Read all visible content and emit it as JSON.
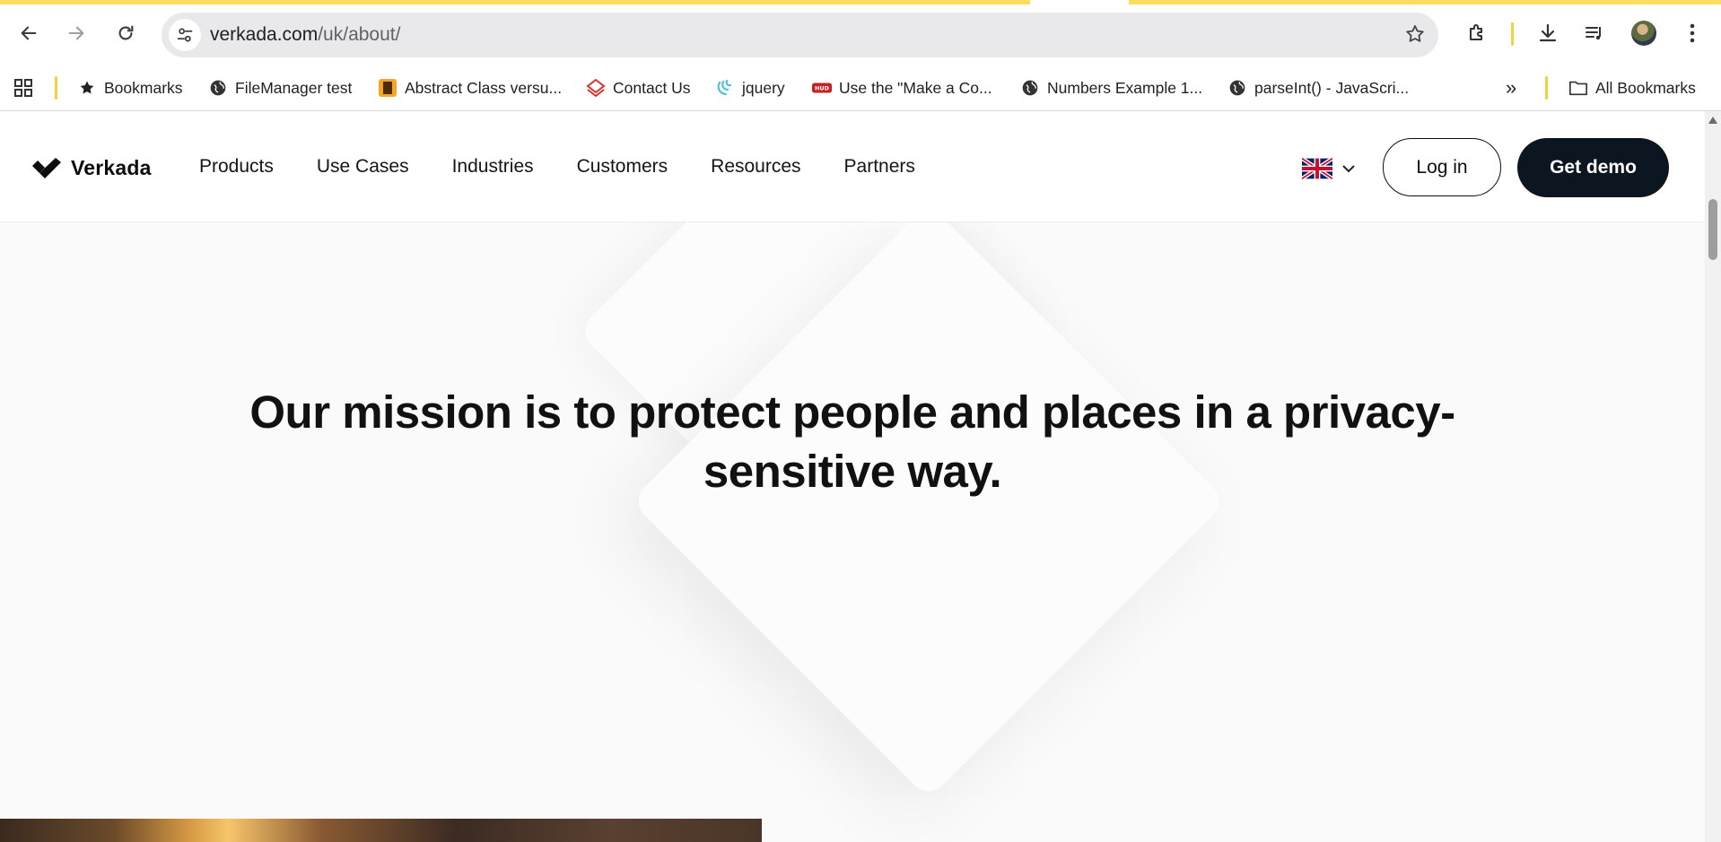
{
  "browser": {
    "url_host": "verkada.com",
    "url_path": "/uk/about/",
    "bookmarks": [
      {
        "label": "Bookmarks",
        "icon": "star-icon"
      },
      {
        "label": "FileManager test",
        "icon": "globe-icon"
      },
      {
        "label": "Abstract Class versu...",
        "icon": "site-favicon-icon"
      },
      {
        "label": "Contact Us",
        "icon": "contact-favicon-icon"
      },
      {
        "label": "jquery",
        "icon": "jquery-favicon-icon"
      },
      {
        "label": "Use the \"Make a Co...",
        "icon": "hud-favicon-icon"
      },
      {
        "label": "Numbers Example 1...",
        "icon": "globe-icon"
      },
      {
        "label": "parseInt() - JavaScri...",
        "icon": "globe-icon"
      }
    ],
    "all_bookmarks": "All Bookmarks",
    "more_label": "»"
  },
  "site": {
    "brand": "Verkada",
    "nav": [
      "Products",
      "Use Cases",
      "Industries",
      "Customers",
      "Resources",
      "Partners"
    ],
    "login": "Log in",
    "demo": "Get demo",
    "mission": "Our mission is to protect people and places in a privacy-sensitive way."
  },
  "colors": {
    "accent_yellow": "#f8dd5f",
    "demo_button": "#0b1620",
    "page_bg": "#fafafa"
  }
}
